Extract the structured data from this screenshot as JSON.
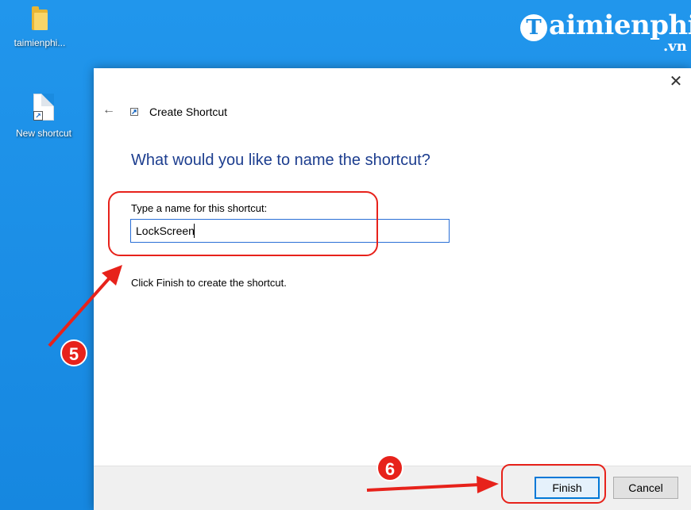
{
  "desktop": {
    "icons": [
      {
        "label": "taimienphi...",
        "icon": "folder-icon"
      },
      {
        "label": "New shortcut",
        "icon": "shortcut-file-icon"
      }
    ],
    "brand": {
      "main": "aimienphi",
      "suffix": ".vn",
      "logo_letter": "T"
    }
  },
  "dialog": {
    "title": "Create Shortcut",
    "heading": "What would you like to name the shortcut?",
    "field_label": "Type a name for this shortcut:",
    "field_value": "LockScreen",
    "hint": "Click Finish to create the shortcut.",
    "buttons": {
      "finish": "Finish",
      "cancel": "Cancel"
    },
    "close_glyph": "✕",
    "back_glyph": "←"
  },
  "annotations": {
    "step_5": "5",
    "step_6": "6",
    "color": "#e7221b"
  },
  "colors": {
    "desktop_bg": "#1a8be0",
    "heading": "#1d3e8f",
    "input_border": "#2a6fd6",
    "finish_border": "#0078d7"
  }
}
